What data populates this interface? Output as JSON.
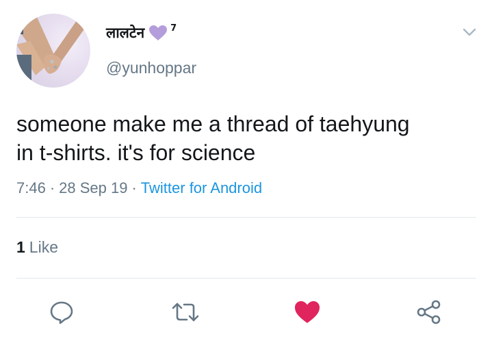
{
  "tweet": {
    "display_name": "लालटेन",
    "superscript": "7",
    "handle": "@yunhoppar",
    "text": "someone make me a thread of taehyung\nin t-shirts. it's for science",
    "time": "7:46",
    "date": "28 Sep 19",
    "separator": "·",
    "source": "Twitter for Android",
    "like_count": "1",
    "like_label": "Like"
  },
  "icons": {
    "name_emoji": "purple-heart-icon",
    "menu": "chevron-down-icon",
    "reply": "reply-icon",
    "retweet": "retweet-icon",
    "like": "heart-icon",
    "share": "share-icon"
  },
  "colors": {
    "text": "#14171a",
    "secondary": "#657786",
    "link": "#1b95e0",
    "like_active": "#e0245e",
    "purple_heart": "#b39ddb",
    "divider": "#e1e8ed"
  }
}
